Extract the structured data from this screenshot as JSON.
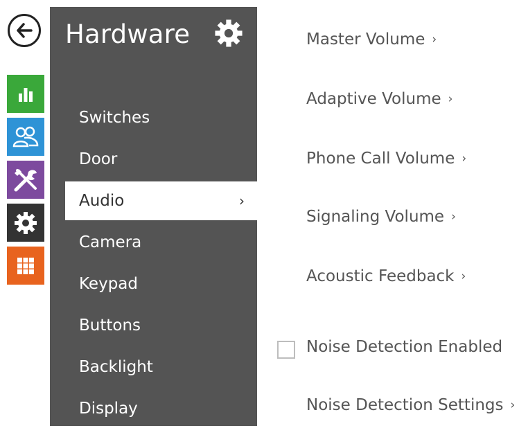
{
  "rail": {
    "items": [
      {
        "name": "status",
        "color": "#3aa83a",
        "icon": "bar-chart-icon"
      },
      {
        "name": "directory",
        "color": "#2e93d6",
        "icon": "users-icon"
      },
      {
        "name": "services",
        "color": "#7d4a9e",
        "icon": "tools-icon"
      },
      {
        "name": "hardware",
        "color": "#333333",
        "icon": "gear-icon"
      },
      {
        "name": "system",
        "color": "#e8631e",
        "icon": "grid-icon"
      }
    ]
  },
  "panel": {
    "title": "Hardware",
    "items": [
      {
        "label": "Switches",
        "active": false
      },
      {
        "label": "Door",
        "active": false
      },
      {
        "label": "Audio",
        "active": true,
        "chevron": "›"
      },
      {
        "label": "Camera",
        "active": false
      },
      {
        "label": "Keypad",
        "active": false
      },
      {
        "label": "Buttons",
        "active": false
      },
      {
        "label": "Backlight",
        "active": false
      },
      {
        "label": "Display",
        "active": false
      }
    ]
  },
  "content": {
    "links": [
      {
        "label": "Master Volume",
        "arrow": "›"
      },
      {
        "label": "Adaptive Volume",
        "arrow": "›"
      },
      {
        "label": "Phone Call Volume",
        "arrow": "›"
      },
      {
        "label": "Signaling Volume",
        "arrow": "›"
      },
      {
        "label": "Acoustic Feedback",
        "arrow": "›"
      }
    ],
    "noise_detection": {
      "label": "Noise Detection Enabled",
      "checked": false
    },
    "noise_settings": {
      "label": "Noise Detection Settings",
      "arrow": "›"
    }
  }
}
